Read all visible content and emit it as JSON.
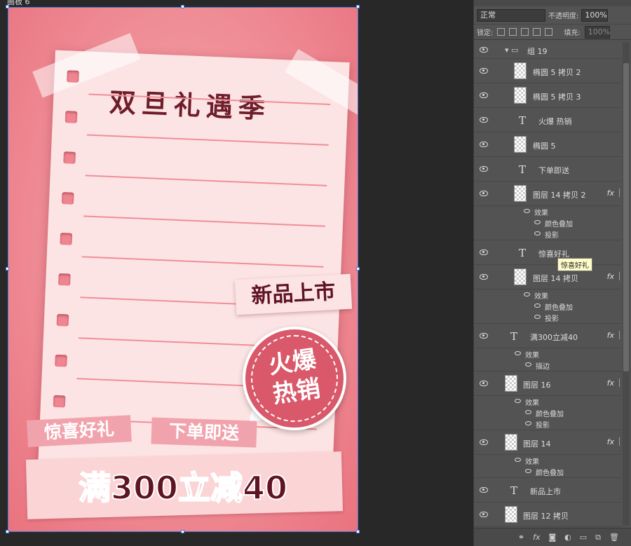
{
  "document": {
    "tab_title": "画板 6"
  },
  "poster": {
    "title": "双旦礼遇季",
    "new_tag": "新品上市",
    "hot_badge_line1": "火爆",
    "hot_badge_line2": "热销",
    "gift_ribbon": "惊喜好礼",
    "order_ribbon": "下单即送",
    "promo": "满300立减40"
  },
  "panel": {
    "blend_mode": "正常",
    "opacity_label": "不透明度:",
    "opacity_value": "100%",
    "lock_label": "锁定:",
    "fill_label": "填充:",
    "fill_value": "100%",
    "tooltip": "惊喜好礼",
    "layers": [
      {
        "name": "组 19",
        "kind": "group"
      },
      {
        "name": "椭圆 5 拷贝 2",
        "kind": "shape"
      },
      {
        "name": "椭圆 5 拷贝 3",
        "kind": "shape"
      },
      {
        "name": "火爆 热销",
        "kind": "text"
      },
      {
        "name": "椭圆 5",
        "kind": "shape"
      },
      {
        "name": "下单即送",
        "kind": "text"
      },
      {
        "name": "图层 14 拷贝 2",
        "kind": "pixel",
        "fx": "fx",
        "effects_label": "效果",
        "effects": [
          "颜色叠加",
          "投影"
        ]
      },
      {
        "name": "惊喜好礼",
        "kind": "text"
      },
      {
        "name": "图层 14 拷贝",
        "kind": "pixel",
        "fx": "fx",
        "effects_label": "效果",
        "effects": [
          "颜色叠加",
          "投影"
        ]
      },
      {
        "name": "满300立减40",
        "kind": "text",
        "fx": "fx",
        "effects_label": "效果",
        "effects": [
          "描边"
        ]
      },
      {
        "name": "图层 16",
        "kind": "pixel",
        "fx": "fx",
        "effects_label": "效果",
        "effects": [
          "颜色叠加",
          "投影"
        ]
      },
      {
        "name": "图层 14",
        "kind": "pixel",
        "fx": "fx",
        "effects_label": "效果",
        "effects": [
          "颜色叠加"
        ]
      },
      {
        "name": "新品上市",
        "kind": "text"
      },
      {
        "name": "图层 12 拷贝",
        "kind": "pixel"
      }
    ],
    "bottom_icons": [
      "link-icon",
      "fx-icon",
      "mask-icon",
      "adjustment-icon",
      "folder-icon",
      "new-layer-icon",
      "trash-icon"
    ]
  }
}
